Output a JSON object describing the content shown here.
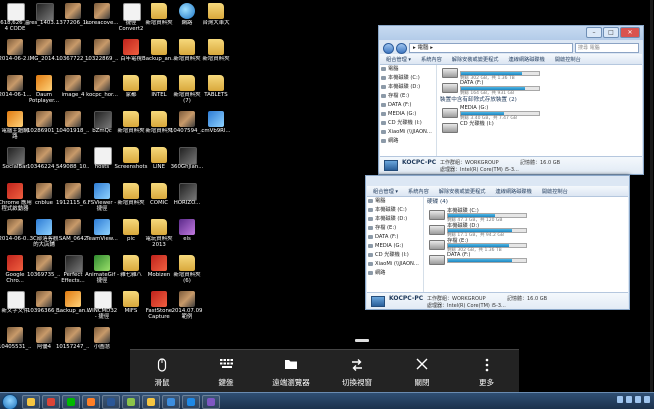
{
  "desktop_icons": [
    {
      "label": "618,626 溫 4 CODE",
      "kind": "doc",
      "col": 0,
      "row": 0
    },
    {
      "label": "res_1403...",
      "kind": "dark",
      "col": 1,
      "row": 0
    },
    {
      "label": "1377206_1...",
      "kind": "photo",
      "col": 2,
      "row": 0
    },
    {
      "label": "koreacove...",
      "kind": "photo",
      "col": 3,
      "row": 0
    },
    {
      "label": "捷徑 Convert2",
      "kind": "doc",
      "col": 4,
      "row": 0
    },
    {
      "label": "新增資料夾",
      "kind": "folder",
      "col": 5,
      "row": 0
    },
    {
      "label": "網路",
      "kind": "globe",
      "col": 6,
      "row": 0
    },
    {
      "label": "台灣大車大",
      "kind": "folder",
      "col": 7,
      "row": 0
    },
    {
      "label": "2014-06-2...",
      "kind": "photo",
      "col": 0,
      "row": 1
    },
    {
      "label": "IMG_2014...",
      "kind": "photo",
      "col": 1,
      "row": 1
    },
    {
      "label": "10367722_...",
      "kind": "photo",
      "col": 2,
      "row": 1
    },
    {
      "label": "10322869_...",
      "kind": "photo",
      "col": 3,
      "row": 1
    },
    {
      "label": "百年電視",
      "kind": "red",
      "col": 4,
      "row": 1
    },
    {
      "label": "Backup_an...",
      "kind": "folder",
      "col": 5,
      "row": 1
    },
    {
      "label": "新增資料夾",
      "kind": "folder",
      "col": 6,
      "row": 1
    },
    {
      "label": "新增資料夾",
      "kind": "folder",
      "col": 7,
      "row": 1
    },
    {
      "label": "2014-06-1...",
      "kind": "photo",
      "col": 0,
      "row": 2
    },
    {
      "label": "Daum Potplayer...",
      "kind": "orange",
      "col": 1,
      "row": 2
    },
    {
      "label": "image_4",
      "kind": "photo",
      "col": 2,
      "row": 2
    },
    {
      "label": "kocpc_hor...",
      "kind": "photo",
      "col": 3,
      "row": 2
    },
    {
      "label": "家都",
      "kind": "folder",
      "col": 4,
      "row": 2
    },
    {
      "label": "INTEL",
      "kind": "folder",
      "col": 5,
      "row": 2
    },
    {
      "label": "新增資料夾 (7)",
      "kind": "folder",
      "col": 6,
      "row": 2
    },
    {
      "label": "TABLETS",
      "kind": "folder",
      "col": 7,
      "row": 2
    },
    {
      "label": "電腦主題網 路",
      "kind": "orange",
      "col": 0,
      "row": 3
    },
    {
      "label": "10286901_...",
      "kind": "photo",
      "col": 1,
      "row": 3
    },
    {
      "label": "10401918_...",
      "kind": "photo",
      "col": 2,
      "row": 3
    },
    {
      "label": "bZmQc",
      "kind": "dark",
      "col": 3,
      "row": 3
    },
    {
      "label": "新增資料夾",
      "kind": "folder",
      "col": 4,
      "row": 3
    },
    {
      "label": "新增資料夾",
      "kind": "folder",
      "col": 5,
      "row": 3
    },
    {
      "label": "10407594_...",
      "kind": "photo",
      "col": 6,
      "row": 3
    },
    {
      "label": "cmVb9Rl...",
      "kind": "app",
      "col": 7,
      "row": 3
    },
    {
      "label": "SocialBar",
      "kind": "dark",
      "col": 0,
      "row": 4
    },
    {
      "label": "10346224_...",
      "kind": "photo",
      "col": 1,
      "row": 4
    },
    {
      "label": "549088_10...",
      "kind": "photo",
      "col": 2,
      "row": 4
    },
    {
      "label": "hosts",
      "kind": "doc",
      "col": 3,
      "row": 4
    },
    {
      "label": "Screenshots",
      "kind": "folder",
      "col": 4,
      "row": 4
    },
    {
      "label": "LINE",
      "kind": "folder",
      "col": 5,
      "row": 4
    },
    {
      "label": "360Ghjian...",
      "kind": "dark",
      "col": 6,
      "row": 4
    },
    {
      "label": "Chrome 應用程式啟動器",
      "kind": "red",
      "col": 0,
      "row": 5
    },
    {
      "label": "cnblue",
      "kind": "photo",
      "col": 1,
      "row": 5
    },
    {
      "label": "1912115_6...",
      "kind": "photo",
      "col": 2,
      "row": 5
    },
    {
      "label": "FSViewer - 捷徑",
      "kind": "app",
      "col": 3,
      "row": 5
    },
    {
      "label": "新增資料夾",
      "kind": "folder",
      "col": 4,
      "row": 5
    },
    {
      "label": "COMIC",
      "kind": "folder",
      "col": 5,
      "row": 5
    },
    {
      "label": "HORIZO...",
      "kind": "dark",
      "col": 6,
      "row": 5
    },
    {
      "label": "2014-06-0...",
      "kind": "photo",
      "col": 0,
      "row": 6
    },
    {
      "label": "3C部落客觀 的大店鋪",
      "kind": "app",
      "col": 1,
      "row": 6
    },
    {
      "label": "SAM_0642",
      "kind": "photo",
      "col": 2,
      "row": 6
    },
    {
      "label": "TeamView...",
      "kind": "app",
      "col": 3,
      "row": 6
    },
    {
      "label": "pic",
      "kind": "folder",
      "col": 4,
      "row": 6
    },
    {
      "label": "電玩資料夾 2013",
      "kind": "folder",
      "col": 5,
      "row": 6
    },
    {
      "label": "els",
      "kind": "purple",
      "col": 6,
      "row": 6
    },
    {
      "label": "Google Chro...",
      "kind": "red",
      "col": 0,
      "row": 7
    },
    {
      "label": "10369735_...",
      "kind": "photo",
      "col": 1,
      "row": 7
    },
    {
      "label": "Perfect Effects...",
      "kind": "dark",
      "col": 2,
      "row": 7
    },
    {
      "label": "AnimateGif - 捷徑",
      "kind": "green",
      "col": 3,
      "row": 7
    },
    {
      "label": "雜七雜八",
      "kind": "folder",
      "col": 4,
      "row": 7
    },
    {
      "label": "Mobizen",
      "kind": "red",
      "col": 5,
      "row": 7
    },
    {
      "label": "新增資料夾 (6)",
      "kind": "folder",
      "col": 6,
      "row": 7
    },
    {
      "label": "新文字文件",
      "kind": "doc",
      "col": 0,
      "row": 8
    },
    {
      "label": "10396366_...",
      "kind": "photo",
      "col": 1,
      "row": 8
    },
    {
      "label": "Backup_an...",
      "kind": "orange",
      "col": 2,
      "row": 8
    },
    {
      "label": "WINCMD32 - 捷徑",
      "kind": "doc",
      "col": 3,
      "row": 8
    },
    {
      "label": "MIFS",
      "kind": "folder",
      "col": 4,
      "row": 8
    },
    {
      "label": "FastStone Capture",
      "kind": "red",
      "col": 5,
      "row": 8
    },
    {
      "label": "2014.07.09 範例",
      "kind": "photo",
      "col": 6,
      "row": 8
    },
    {
      "label": "10405531_...",
      "kind": "photo",
      "col": 0,
      "row": 9
    },
    {
      "label": "阿優4",
      "kind": "photo",
      "col": 1,
      "row": 9
    },
    {
      "label": "10157247_...",
      "kind": "photo",
      "col": 2,
      "row": 9
    },
    {
      "label": "小圖慧",
      "kind": "photo",
      "col": 3,
      "row": 9
    }
  ],
  "win1": {
    "address": "▸ 電腦 ▸",
    "search_placeholder": "搜尋 電腦",
    "toolbar": [
      "組合管理 ▾",
      "系統內容",
      "解除安裝或變更程式",
      "連線網路磁碟機",
      "開啟控制台"
    ],
    "nav": [
      "電腦",
      "本機磁碟 (C:)",
      "本機磁碟 (D:)",
      "存檔 (E:)",
      "DATA (F:)",
      "MEDIA (G:)",
      "CD 光碟機 (I:)",
      "XiaoMi (\\\\JIAON...",
      "網路"
    ],
    "drives": [
      {
        "name": "",
        "free": "剩餘 302 GB，共 1.36 TB",
        "fill": 0.78
      },
      {
        "name": "DATA (F:)",
        "free": "剩餘 164 GB，共 931 GB",
        "fill": 0.82
      }
    ],
    "group_removable": "裝置中含有卸除式存放裝置 (2)",
    "removable": [
      {
        "name": "MEDIA (G:)",
        "free": "剩餘 3.40 GB，共 7.47 GB",
        "fill": 0.55
      },
      {
        "name": "CD 光碟機 (I:)",
        "free": "",
        "fill": 0
      }
    ],
    "details": {
      "pc": "KOCPC-PC",
      "workgroup": "工作群組：WORKGROUP",
      "memory": "記憶體：16.0 GB",
      "cpu": "處理器：Intel(R) Core(TM) i5-3..."
    }
  },
  "win2": {
    "toolbar": [
      "組合管理 ▾",
      "系統內容",
      "解除安裝或變更程式",
      "連線網路磁碟機",
      "開啟控制台"
    ],
    "group_hdd": "硬碟 (4)",
    "nav": [
      "電腦",
      "本機磁碟 (C:)",
      "本機磁碟 (D:)",
      "存檔 (E:)",
      "DATA (F:)",
      "MEDIA (G:)",
      "CD 光碟機 (I:)",
      "XiaoMi (\\\\JIAON...",
      "網路"
    ],
    "drives": [
      {
        "name": "本機磁碟 (C:)",
        "free": "剩餘 47.3 GB，共 120 GB",
        "fill": 0.6
      },
      {
        "name": "本機磁碟 (D:)",
        "free": "剩餘 17.1 GB，共 94.2 GB",
        "fill": 0.82
      },
      {
        "name": "存檔 (E:)",
        "free": "剩餘 302 GB，共 1.36 TB",
        "fill": 0.78
      },
      {
        "name": "DATA (F:)",
        "free": "",
        "fill": 0.82
      }
    ],
    "details": {
      "pc": "KOCPC-PC",
      "workgroup": "工作群組：WORKGROUP",
      "memory": "記憶體：16.0 GB",
      "cpu": "處理器：Intel(R) Core(TM) i5-3..."
    }
  },
  "remote_toolbar": {
    "buttons": [
      {
        "id": "mouse",
        "label": "滑鼠",
        "icon": "mouse-icon"
      },
      {
        "id": "keyboard",
        "label": "鍵盤",
        "icon": "keyboard-icon"
      },
      {
        "id": "remote-browser",
        "label": "遠端瀏覽器",
        "icon": "folder-icon"
      },
      {
        "id": "switch-view",
        "label": "切換視窗",
        "icon": "switch-icon"
      },
      {
        "id": "close",
        "label": "關閉",
        "icon": "close-icon"
      },
      {
        "id": "more",
        "label": "更多",
        "icon": "more-icon"
      }
    ]
  },
  "taskbar": {
    "apps": [
      "explorer",
      "chrome",
      "line",
      "media",
      "word",
      "photo",
      "screenshots",
      "remote",
      "ie",
      "store"
    ]
  }
}
